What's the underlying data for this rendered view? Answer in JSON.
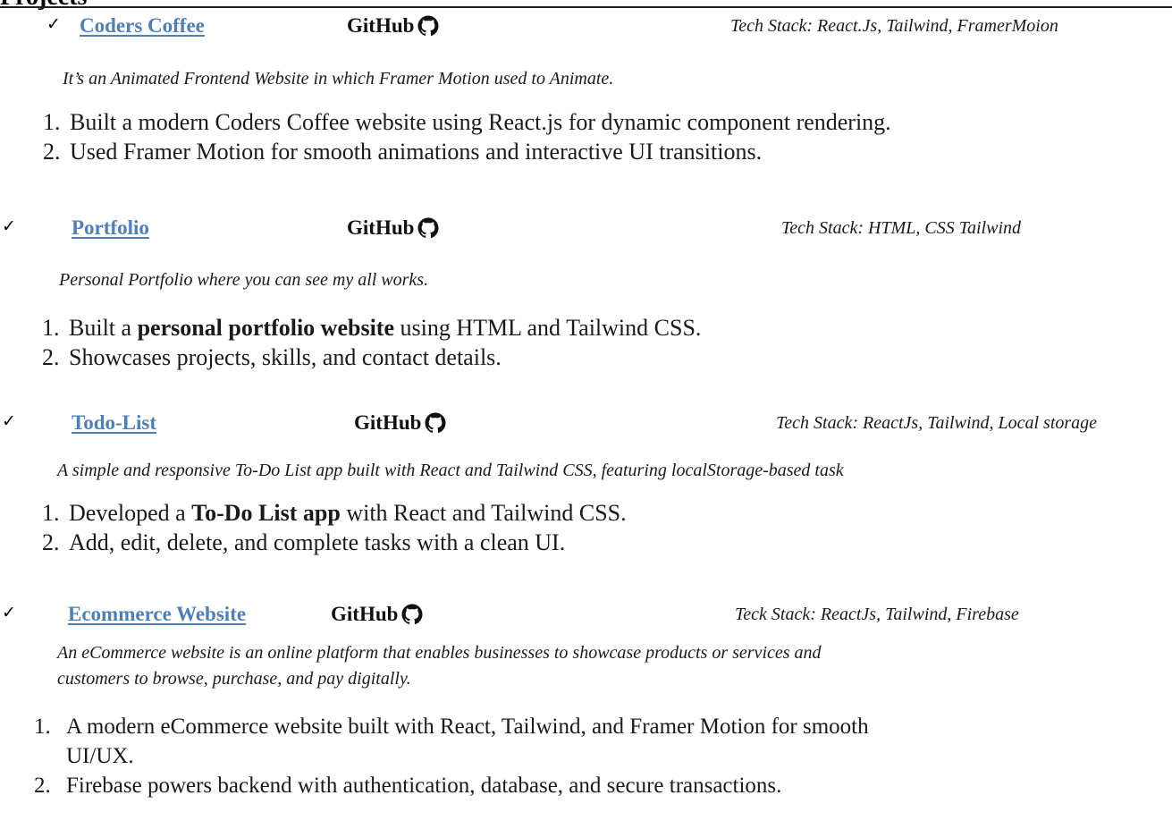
{
  "section": {
    "heading": "Projects"
  },
  "projects": [
    {
      "title": "Coders Coffee",
      "github_label": "GitHub",
      "tech_stack": "Tech Stack: React.Js, Tailwind, FramerMoion",
      "description": "It’s an Animated Frontend Website in which Framer Motion used to Animate.",
      "bullets": [
        {
          "num": "1.",
          "pre": "Built a modern Coders Coffee website using React.js for dynamic component rendering.",
          "bold": "",
          "post": ""
        },
        {
          "num": "2.",
          "pre": "Used Framer Motion for smooth animations and interactive UI transitions.",
          "bold": "",
          "post": ""
        }
      ]
    },
    {
      "title": "Portfolio",
      "github_label": "GitHub",
      "tech_stack": "Tech Stack:  HTML, CSS Tailwind",
      "description": "Personal Portfolio where you can see my all works.",
      "bullets": [
        {
          "num": "1.",
          "pre": "Built a ",
          "bold": "personal portfolio website",
          "post": " using HTML and Tailwind CSS."
        },
        {
          "num": "2.",
          "pre": "Showcases projects, skills, and contact details.",
          "bold": "",
          "post": ""
        }
      ]
    },
    {
      "title": "Todo-List",
      "github_label": "GitHub",
      "tech_stack": "Tech Stack:  ReactJs, Tailwind, Local storage",
      "description": "A simple and responsive To-Do List app built with React and Tailwind CSS, featuring localStorage-based task",
      "bullets": [
        {
          "num": "1.",
          "pre": "Developed a ",
          "bold": "To-Do List app",
          "post": " with React and Tailwind CSS."
        },
        {
          "num": "2.",
          "pre": "Add, edit, delete, and complete tasks with a clean UI.",
          "bold": "",
          "post": ""
        }
      ]
    },
    {
      "title": "Ecommerce Website",
      "github_label": "GitHub",
      "tech_stack": "Teck Stack: ReactJs, Tailwind, Firebase",
      "description_lines": [
        "An eCommerce website is an online platform that enables businesses to showcase products or services and",
        "customers to browse, purchase, and pay digitally."
      ],
      "bullets": [
        {
          "num": "1.",
          "pre": "A modern eCommerce website built with React, Tailwind, and Framer Motion for smooth",
          "bold": "",
          "post": "",
          "cont": "UI/UX."
        },
        {
          "num": "2.",
          "pre": "Firebase powers backend with authentication, database, and secure transactions.",
          "bold": "",
          "post": ""
        }
      ]
    }
  ]
}
